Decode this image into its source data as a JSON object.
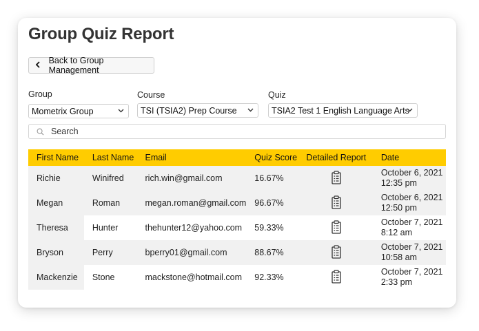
{
  "page": {
    "title": "Group Quiz Report",
    "back_label": "Back to Group Management"
  },
  "filters": {
    "group": {
      "label": "Group",
      "value": "Mometrix Group"
    },
    "course": {
      "label": "Course",
      "value": "TSI (TSIA2) Prep Course"
    },
    "quiz": {
      "label": "Quiz",
      "value": "TSIA2 Test 1 English Language Arts"
    }
  },
  "search": {
    "placeholder": "Search"
  },
  "colors": {
    "accent": "#ffcc00",
    "row_shade": "#f1f1f1"
  },
  "icons": {
    "back": "chevron-left",
    "search": "magnifier",
    "report": "clipboard-list",
    "select": "chevron-down"
  },
  "table": {
    "columns": [
      "First Name",
      "Last Name",
      "Email",
      "Quiz Score",
      "Detailed Report",
      "Date"
    ],
    "rows": [
      {
        "first": "Richie",
        "last": "Winifred",
        "email": "rich.win@gmail.com",
        "score": "16.67%",
        "date": "October 6, 2021",
        "time": "12:35 pm"
      },
      {
        "first": "Megan",
        "last": "Roman",
        "email": "megan.roman@gmail.com",
        "score": "96.67%",
        "date": "October 6, 2021",
        "time": "12:50 pm"
      },
      {
        "first": "Theresa",
        "last": "Hunter",
        "email": "thehunter12@yahoo.com",
        "score": "59.33%",
        "date": "October 7, 2021",
        "time": "8:12 am"
      },
      {
        "first": "Bryson",
        "last": "Perry",
        "email": "bperry01@gmail.com",
        "score": "88.67%",
        "date": "October 7, 2021",
        "time": "10:58 am"
      },
      {
        "first": "Mackenzie",
        "last": "Stone",
        "email": "mackstone@hotmail.com",
        "score": "92.33%",
        "date": "October 7, 2021",
        "time": "2:33 pm"
      }
    ]
  }
}
